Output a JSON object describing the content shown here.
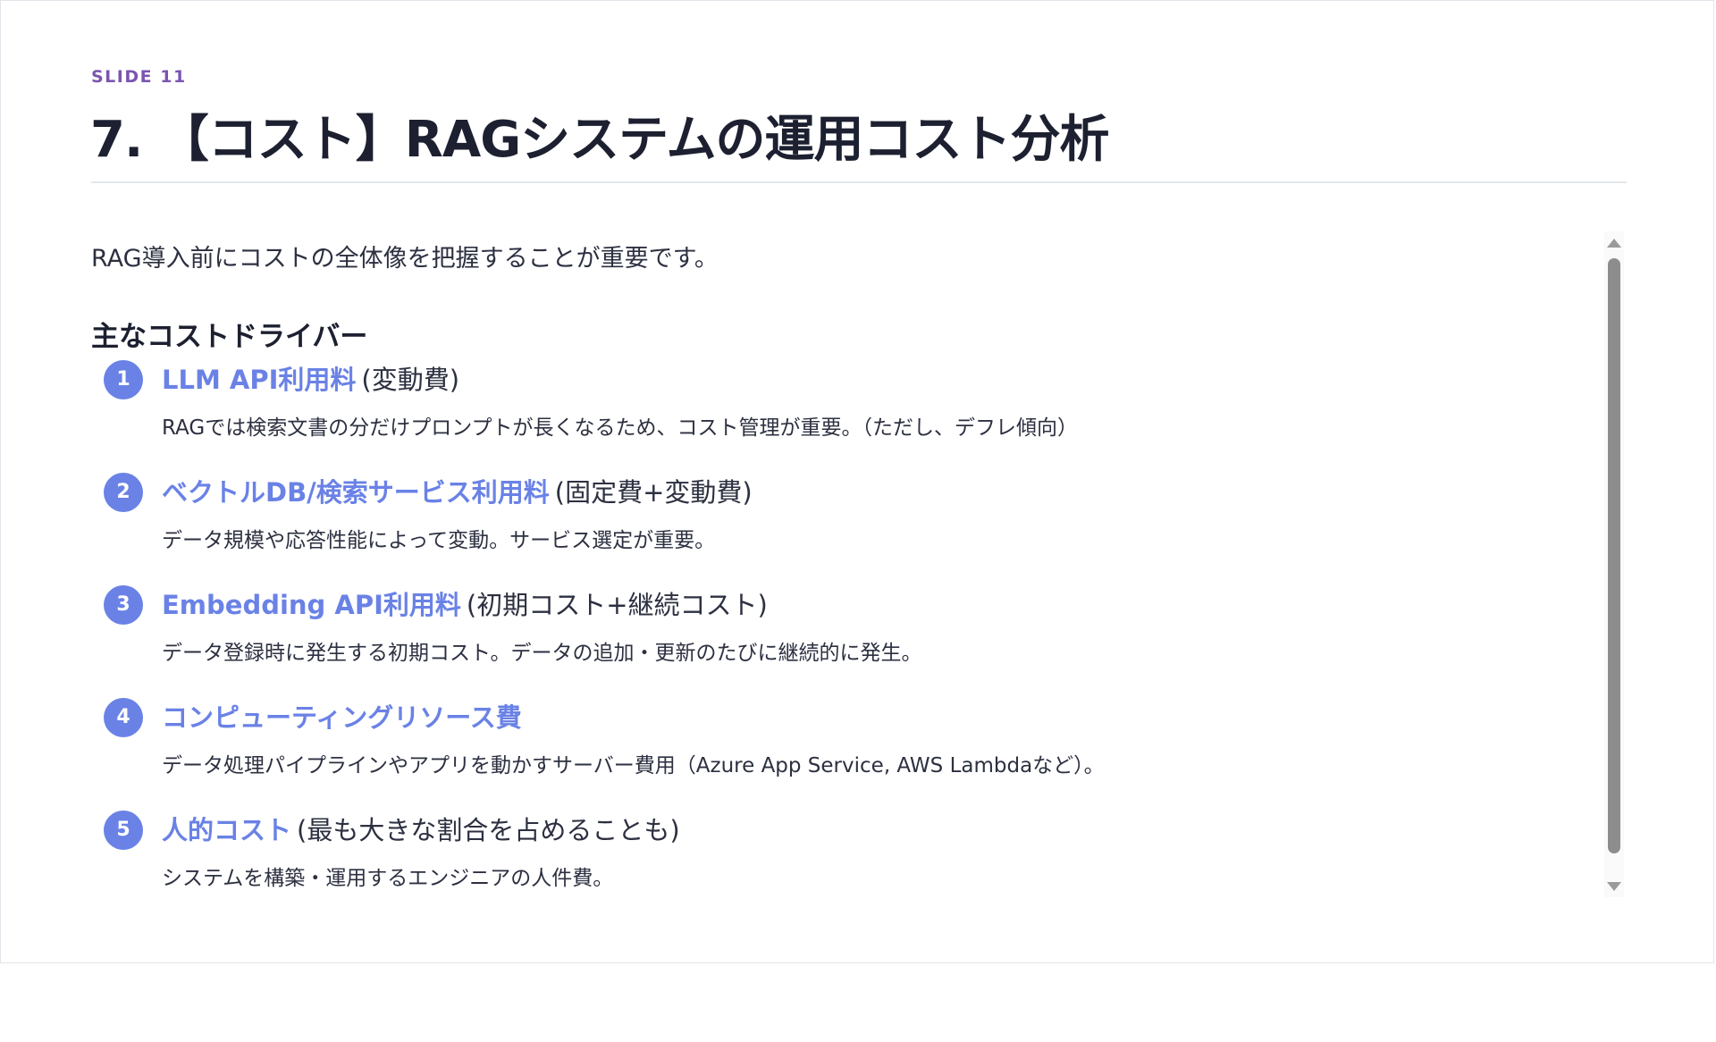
{
  "slide": {
    "label": "SLIDE 11",
    "title": "7. 【コスト】RAGシステムの運用コスト分析"
  },
  "content": {
    "intro": "RAG導入前にコストの全体像を把握することが重要です。",
    "section_heading": "主なコストドライバー",
    "drivers": [
      {
        "number": "1",
        "name": "LLM API利用料",
        "tag": "(変動費)",
        "description": "RAGでは検索文書の分だけプロンプトが長くなるため、コスト管理が重要。（ただし、デフレ傾向）"
      },
      {
        "number": "2",
        "name": "ベクトルDB/検索サービス利用料",
        "tag": "(固定費+変動費)",
        "description": "データ規模や応答性能によって変動。サービス選定が重要。"
      },
      {
        "number": "3",
        "name": "Embedding API利用料",
        "tag": "(初期コスト+継続コスト)",
        "description": "データ登録時に発生する初期コスト。データの追加・更新のたびに継続的に発生。"
      },
      {
        "number": "4",
        "name": "コンピューティングリソース費",
        "tag": "",
        "description": "データ処理パイプラインやアプリを動かすサーバー費用（Azure App Service, AWS Lambdaなど）。"
      },
      {
        "number": "5",
        "name": "人的コスト",
        "tag": "(最も大きな割合を占めることも)",
        "description": "システムを構築・運用するエンジニアの人件費。"
      }
    ]
  },
  "colors": {
    "accent": "#6a82e6",
    "label": "#7a55b0",
    "title": "#1c2030",
    "body": "#2c3040"
  }
}
